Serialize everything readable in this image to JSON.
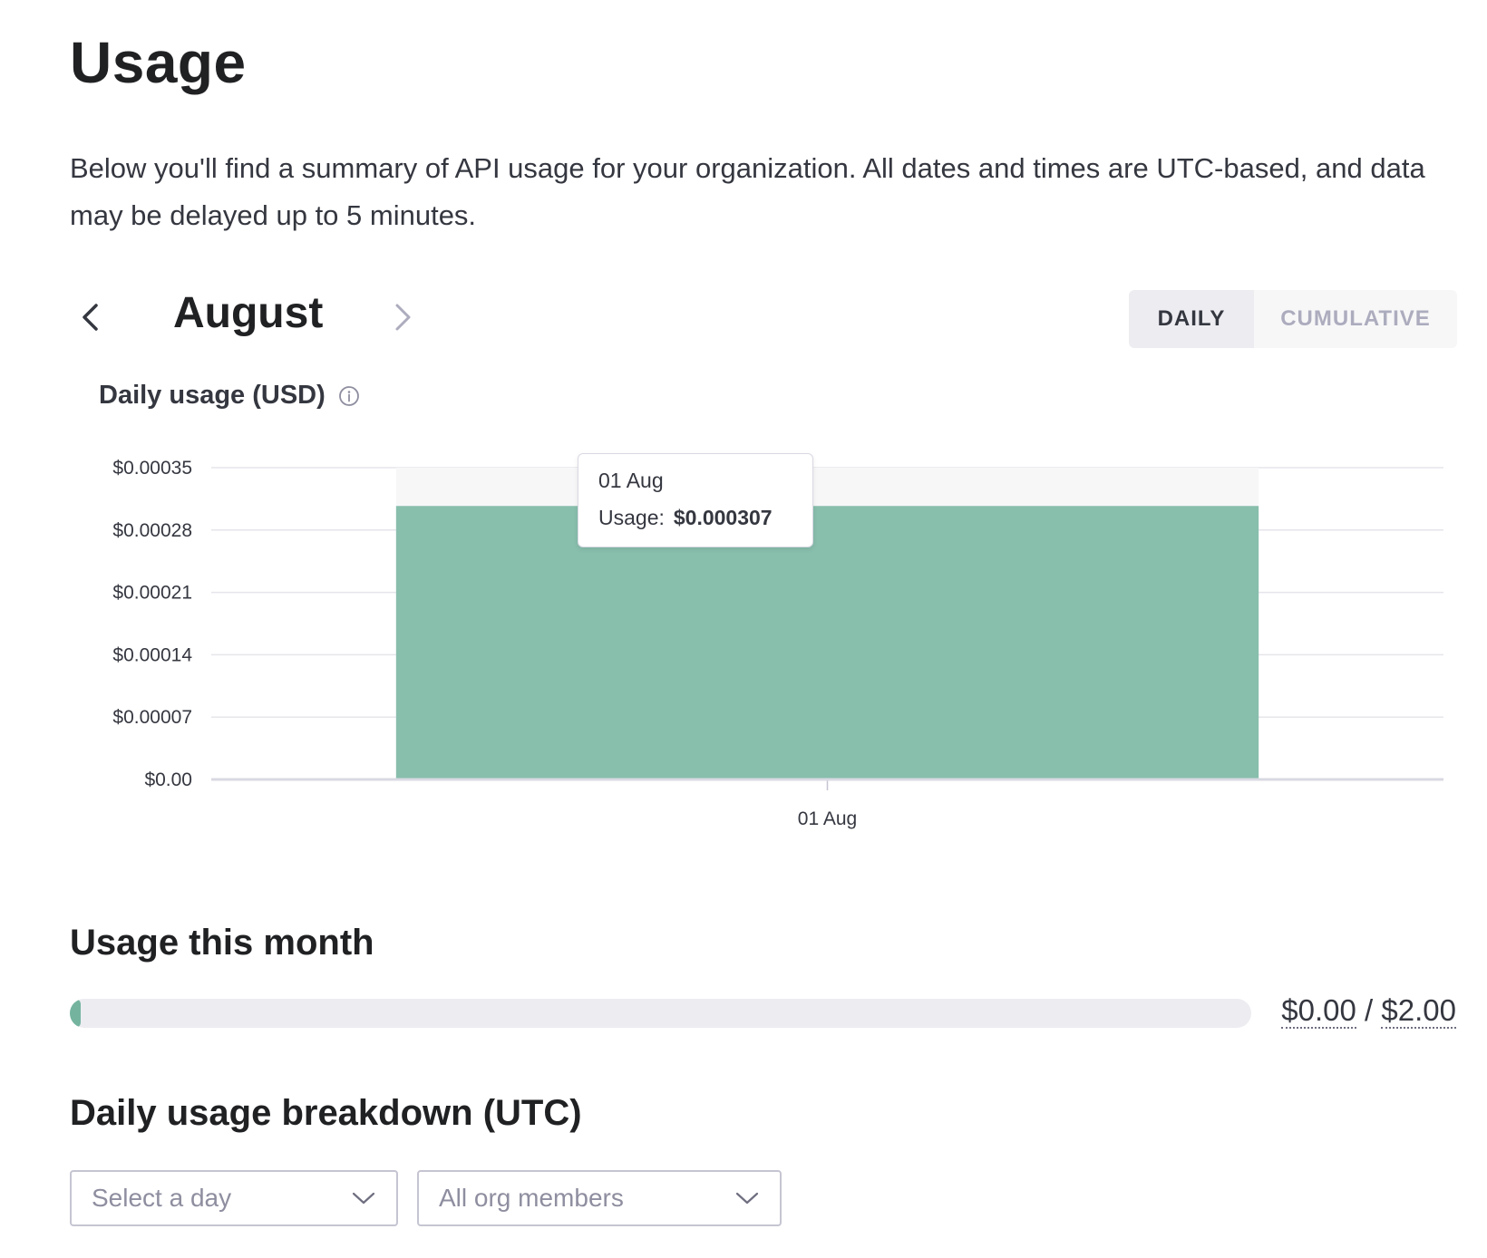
{
  "page": {
    "title": "Usage",
    "intro": "Below you'll find a summary of API usage for your organization. All dates and times are UTC-based, and data may be delayed up to 5 minutes."
  },
  "month_nav": {
    "month": "August",
    "prev_icon": "chevron-left-icon",
    "next_icon": "chevron-right-icon"
  },
  "view_toggle": {
    "daily_label": "DAILY",
    "cumulative_label": "CUMULATIVE",
    "selected": "daily"
  },
  "chart_title": "Daily usage (USD)",
  "info_icon": "info-icon",
  "tooltip": {
    "date": "01 Aug",
    "label": "Usage:",
    "value": "$0.000307"
  },
  "chart_data": {
    "type": "bar",
    "categories": [
      "01 Aug"
    ],
    "values": [
      0.000307
    ],
    "title": "Daily usage (USD)",
    "xlabel": "",
    "ylabel": "",
    "ylim": [
      0,
      0.00035
    ],
    "yticks": [
      0,
      7e-05,
      0.00014,
      0.00021,
      0.00028,
      0.00035
    ],
    "ytick_labels": [
      "$0.00",
      "$0.00007",
      "$0.00014",
      "$0.00021",
      "$0.00028",
      "$0.00035"
    ],
    "grid": true,
    "legend": "none",
    "bar_color": "#74b49f"
  },
  "usage_month": {
    "heading": "Usage this month",
    "used": "$0.00",
    "separator": " / ",
    "limit": "$2.00",
    "fraction": 0.0002
  },
  "breakdown": {
    "heading": "Daily usage breakdown (UTC)",
    "day_placeholder": "Select a day",
    "member_value": "All org members",
    "dropdown_icon": "chevron-down-icon"
  },
  "colors": {
    "accent": "#74b49f",
    "text": "#202123",
    "muted": "#acacbe"
  }
}
